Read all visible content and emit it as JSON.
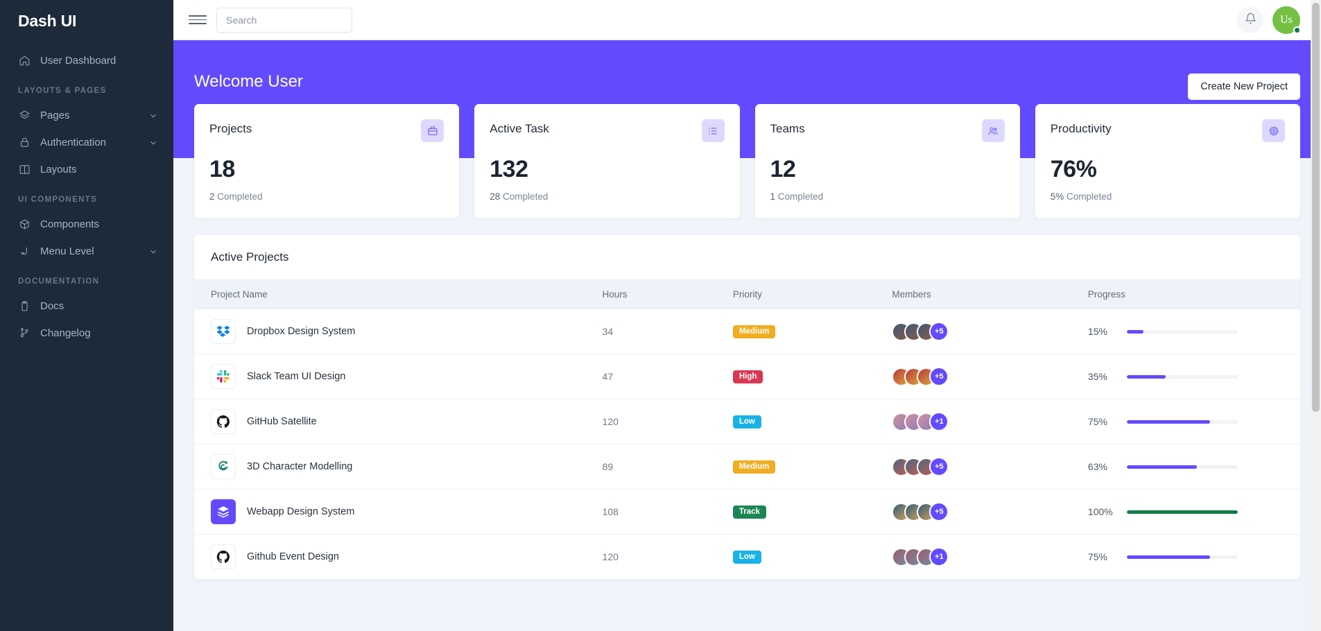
{
  "brand": {
    "name": "Dash UI"
  },
  "sidebar": {
    "items": [
      {
        "label": "User Dashboard",
        "icon": "home-icon",
        "type": "item",
        "chevron": false
      },
      {
        "label": "Layouts & Pages",
        "type": "section"
      },
      {
        "label": "Pages",
        "icon": "layers-icon",
        "type": "item",
        "chevron": true
      },
      {
        "label": "Authentication",
        "icon": "lock-icon",
        "type": "item",
        "chevron": true
      },
      {
        "label": "Layouts",
        "icon": "columns-icon",
        "type": "item",
        "chevron": false
      },
      {
        "label": "UI Components",
        "type": "section"
      },
      {
        "label": "Components",
        "icon": "box-icon",
        "type": "item",
        "chevron": false
      },
      {
        "label": "Menu Level",
        "icon": "arrow-down-left-icon",
        "type": "item",
        "chevron": true
      },
      {
        "label": "Documentation",
        "type": "section"
      },
      {
        "label": "Docs",
        "icon": "clipboard-icon",
        "type": "item",
        "chevron": false
      },
      {
        "label": "Changelog",
        "icon": "git-branch-icon",
        "type": "item",
        "chevron": false
      }
    ]
  },
  "topbar": {
    "menu_icon": "hamburger-icon",
    "search": {
      "value": "",
      "placeholder": "Search"
    },
    "bell_icon": "bell-icon",
    "avatar": {
      "initials": "Us",
      "status": "online",
      "color": "#74bf44"
    }
  },
  "banner": {
    "title": "Welcome User",
    "create_button": "Create New Project",
    "color": "#624bff"
  },
  "stats": [
    {
      "title": "Projects",
      "value": "18",
      "sub_count": "2",
      "sub_label": "Completed",
      "icon": "briefcase-icon"
    },
    {
      "title": "Active Task",
      "value": "132",
      "sub_count": "28",
      "sub_label": "Completed",
      "icon": "list-icon"
    },
    {
      "title": "Teams",
      "value": "12",
      "sub_count": "1",
      "sub_label": "Completed",
      "icon": "users-icon"
    },
    {
      "title": "Productivity",
      "value": "76%",
      "sub_count": "5%",
      "sub_label": "Completed",
      "icon": "target-icon"
    }
  ],
  "projects_table": {
    "title": "Active Projects",
    "columns": [
      "Project Name",
      "Hours",
      "Priority",
      "Members",
      "Progress"
    ],
    "rows": [
      {
        "name": "Dropbox Design System",
        "logo": "dropbox-icon",
        "hours": "34",
        "priority": "Medium",
        "priority_class": "medium",
        "members_extra": "+5",
        "progress": 15,
        "progress_label": "15%",
        "progress_color": "purple"
      },
      {
        "name": "Slack Team UI Design",
        "logo": "slack-icon",
        "hours": "47",
        "priority": "High",
        "priority_class": "high",
        "members_extra": "+5",
        "progress": 35,
        "progress_label": "35%",
        "progress_color": "purple"
      },
      {
        "name": "GitHub Satellite",
        "logo": "github-icon",
        "hours": "120",
        "priority": "Low",
        "priority_class": "low",
        "members_extra": "+1",
        "progress": 75,
        "progress_label": "75%",
        "progress_color": "purple"
      },
      {
        "name": "3D Character Modelling",
        "logo": "spiral-icon",
        "hours": "89",
        "priority": "Medium",
        "priority_class": "medium",
        "members_extra": "+5",
        "progress": 63,
        "progress_label": "63%",
        "progress_color": "purple"
      },
      {
        "name": "Webapp Design System",
        "logo": "stack-icon",
        "hours": "108",
        "priority": "Track",
        "priority_class": "track",
        "members_extra": "+5",
        "progress": 100,
        "progress_label": "100%",
        "progress_color": "green"
      },
      {
        "name": "Github Event Design",
        "logo": "github-icon",
        "hours": "120",
        "priority": "Low",
        "priority_class": "low",
        "members_extra": "+1",
        "progress": 75,
        "progress_label": "75%",
        "progress_color": "purple"
      }
    ]
  }
}
